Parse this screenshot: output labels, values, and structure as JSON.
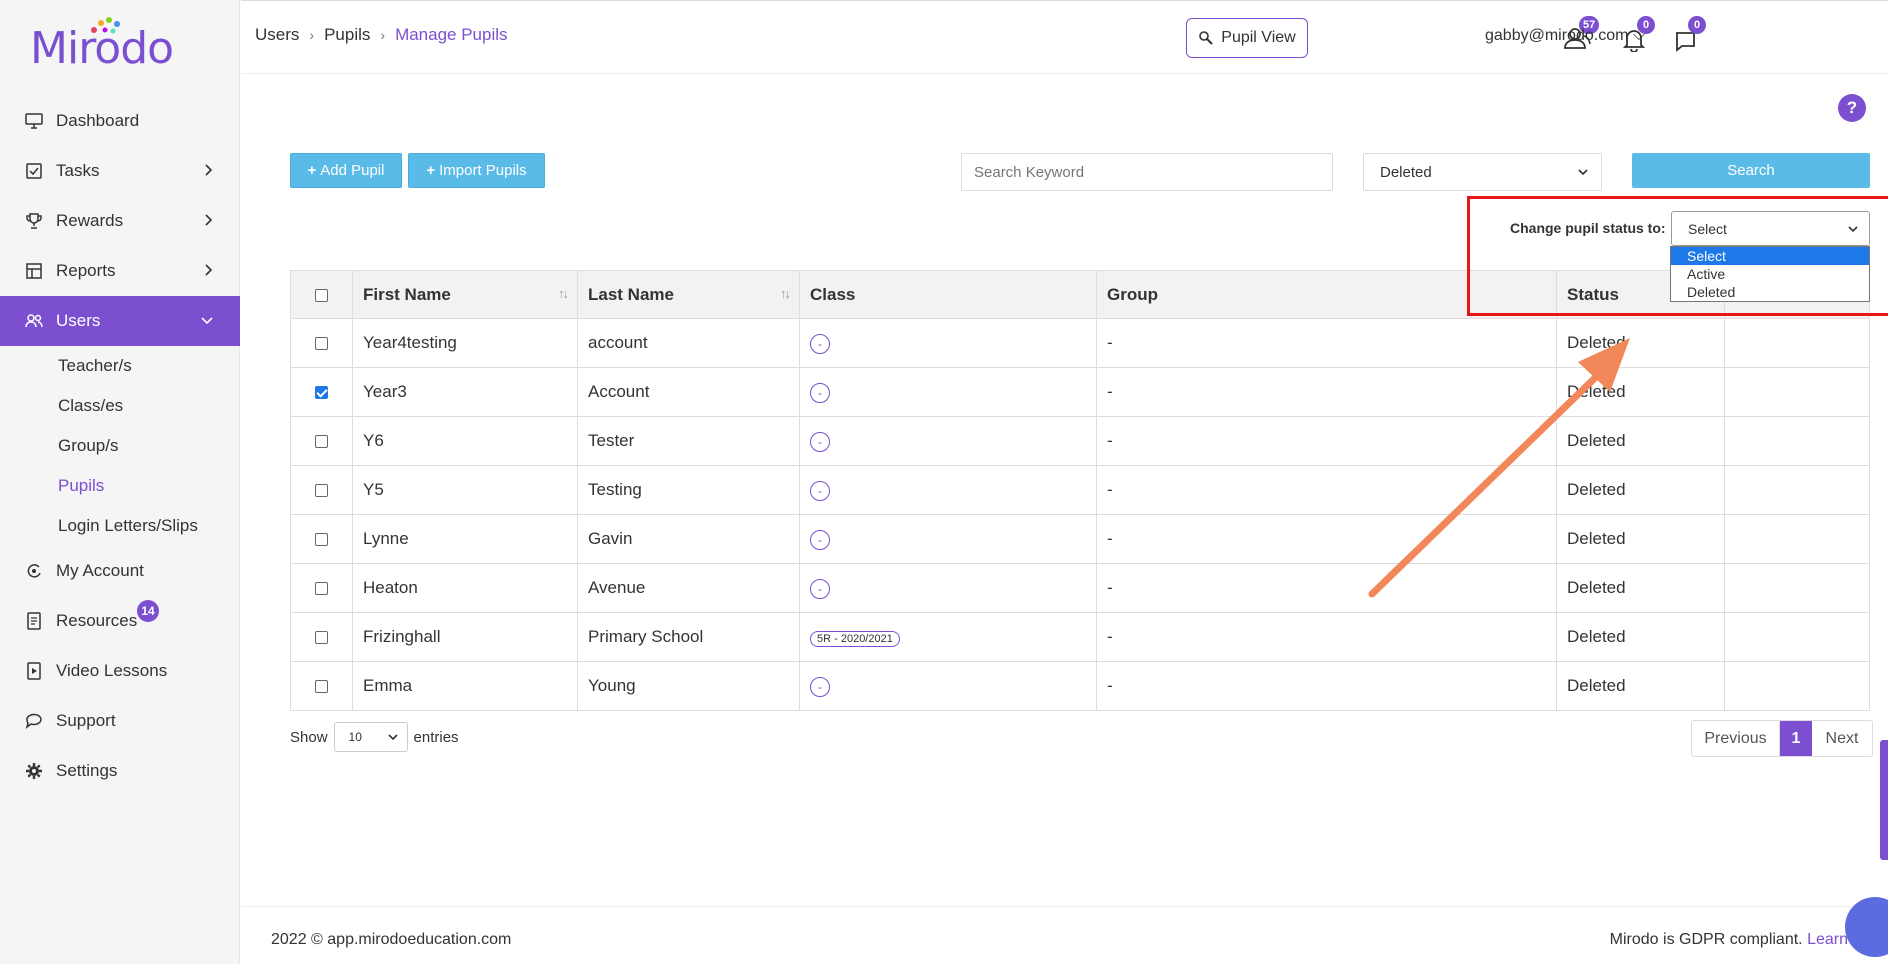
{
  "brand": {
    "logo_text": "Mirodo",
    "accent": "#7b4fd0",
    "button_blue": "#5bbbe8"
  },
  "sidebar": {
    "items": [
      {
        "label": "Dashboard",
        "icon": "monitor-icon"
      },
      {
        "label": "Tasks",
        "icon": "tasks-icon",
        "has_children": true
      },
      {
        "label": "Rewards",
        "icon": "trophy-icon",
        "has_children": true
      },
      {
        "label": "Reports",
        "icon": "report-icon",
        "has_children": true
      },
      {
        "label": "Users",
        "icon": "users-icon",
        "expanded": true,
        "active": true
      },
      {
        "label": "My Account",
        "icon": "account-icon"
      },
      {
        "label": "Resources",
        "icon": "resources-icon",
        "badge": "14"
      },
      {
        "label": "Video Lessons",
        "icon": "video-icon"
      },
      {
        "label": "Support",
        "icon": "support-icon"
      },
      {
        "label": "Settings",
        "icon": "gear-icon"
      }
    ],
    "users_sub": [
      "Teacher/s",
      "Class/es",
      "Group/s",
      "Pupils",
      "Login Letters/Slips"
    ]
  },
  "breadcrumb": {
    "items": [
      "Users",
      "Pupils",
      "Manage Pupils"
    ]
  },
  "topbar": {
    "pupil_view": "Pupil View",
    "users_count": "57",
    "notifications_count": "0",
    "messages_count": "0",
    "user_email": "gabby@mirodo.com",
    "help": "?"
  },
  "toolbar": {
    "add_pupil": "Add Pupil",
    "import_pupils": "Import Pupils",
    "search_placeholder": "Search Keyword",
    "filter_value": "Deleted",
    "search_button": "Search"
  },
  "status_change": {
    "label": "Change pupil status to:",
    "selected": "Select",
    "options": [
      "Select",
      "Active",
      "Deleted"
    ]
  },
  "table": {
    "columns": [
      "First Name",
      "Last Name",
      "Class",
      "Group",
      "Status"
    ],
    "rows": [
      {
        "first": "Year4testing",
        "last": "account",
        "class": "-",
        "group": "-",
        "status": "Deleted",
        "checked": false
      },
      {
        "first": "Year3",
        "last": "Account",
        "class": "-",
        "group": "-",
        "status": "Deleted",
        "checked": true
      },
      {
        "first": "Y6",
        "last": "Tester",
        "class": "-",
        "group": "-",
        "status": "Deleted",
        "checked": false
      },
      {
        "first": "Y5",
        "last": "Testing",
        "class": "-",
        "group": "-",
        "status": "Deleted",
        "checked": false
      },
      {
        "first": "Lynne",
        "last": "Gavin",
        "class": "-",
        "group": "-",
        "status": "Deleted",
        "checked": false
      },
      {
        "first": "Heaton",
        "last": "Avenue",
        "class": "-",
        "group": "-",
        "status": "Deleted",
        "checked": false
      },
      {
        "first": "Frizinghall",
        "last": "Primary School",
        "class": "5R - 2020/2021",
        "group": "-",
        "status": "Deleted",
        "checked": false
      },
      {
        "first": "Emma",
        "last": "Young",
        "class": "-",
        "group": "-",
        "status": "Deleted",
        "checked": false
      }
    ]
  },
  "table_footer": {
    "show_label": "Show",
    "entries_value": "10",
    "entries_label": "entries",
    "previous": "Previous",
    "page": "1",
    "next": "Next"
  },
  "footer": {
    "copyright": "2022 © app.mirodoeducation.com",
    "gdpr": "Mirodo is GDPR compliant.",
    "learn": "Learn"
  }
}
